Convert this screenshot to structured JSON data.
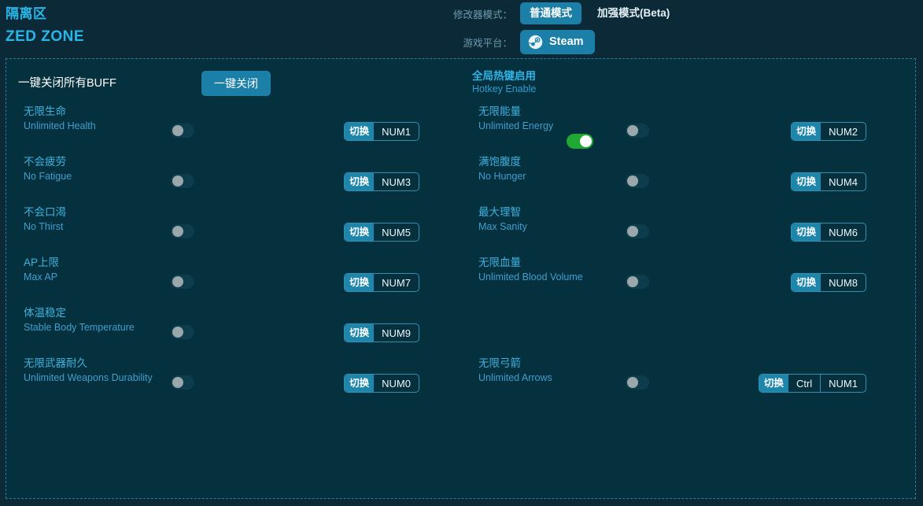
{
  "header": {
    "game_title_cn": "隔离区",
    "game_title_en": "ZED ZONE",
    "mode_label": "修改器模式：",
    "mode_normal": "普通模式",
    "mode_enhanced": "加强模式(Beta)",
    "platform_label": "游戏平台：",
    "platform_name": "Steam",
    "platform_icon": "steam-icon"
  },
  "panel": {
    "onekey_label": "一键关闭所有BUFF",
    "onekey_button": "一键关闭",
    "hotkey_enable_cn": "全局热键启用",
    "hotkey_enable_en": "Hotkey Enable",
    "hotkey_enable_state": "on"
  },
  "cheats": {
    "toggle_action_label": "切换",
    "left": [
      {
        "cn": "无限生命",
        "en": "Unlimited Health",
        "state": "off",
        "keys": [
          "NUM1"
        ]
      },
      {
        "cn": "不会疲劳",
        "en": "No Fatigue",
        "state": "off",
        "keys": [
          "NUM3"
        ]
      },
      {
        "cn": "不会口渴",
        "en": "No Thirst",
        "state": "off",
        "keys": [
          "NUM5"
        ]
      },
      {
        "cn": "AP上限",
        "en": "Max AP",
        "state": "off",
        "keys": [
          "NUM7"
        ]
      },
      {
        "cn": "体温稳定",
        "en": "Stable Body Temperature",
        "state": "off",
        "keys": [
          "NUM9"
        ]
      },
      {
        "cn": "无限武器耐久",
        "en": "Unlimited Weapons Durability",
        "state": "off",
        "keys": [
          "NUM0"
        ]
      }
    ],
    "right": [
      {
        "cn": "无限能量",
        "en": "Unlimited Energy",
        "state": "off",
        "keys": [
          "NUM2"
        ]
      },
      {
        "cn": "满饱腹度",
        "en": "No Hunger",
        "state": "off",
        "keys": [
          "NUM4"
        ]
      },
      {
        "cn": "最大理智",
        "en": "Max Sanity",
        "state": "off",
        "keys": [
          "NUM6"
        ]
      },
      {
        "cn": "无限血量",
        "en": "Unlimited Blood Volume",
        "state": "off",
        "keys": [
          "NUM8"
        ]
      },
      {
        "cn": "",
        "en": "",
        "state": "",
        "keys": []
      },
      {
        "cn": "无限弓箭",
        "en": "Unlimited Arrows",
        "state": "off",
        "keys": [
          "Ctrl",
          "NUM1"
        ]
      }
    ]
  },
  "colors": {
    "page_background": "#0b2936",
    "panel_background": "#05303d",
    "panel_border": "#2e7b96",
    "accent": "#29b6e8",
    "button": "#1c7fa8",
    "toggle_on": "#1fa832",
    "toggle_off_track": "#0d3c4c",
    "toggle_knob_off": "#9aa7ab"
  }
}
